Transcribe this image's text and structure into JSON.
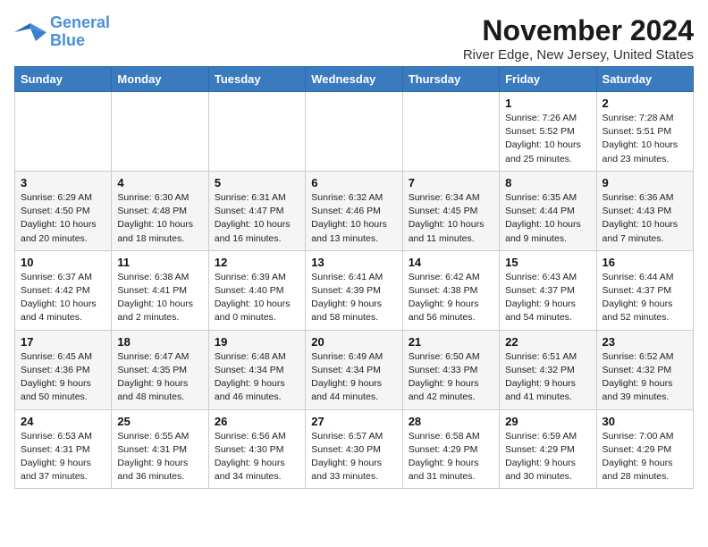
{
  "logo": {
    "line1": "General",
    "line2": "Blue"
  },
  "title": "November 2024",
  "location": "River Edge, New Jersey, United States",
  "weekdays": [
    "Sunday",
    "Monday",
    "Tuesday",
    "Wednesday",
    "Thursday",
    "Friday",
    "Saturday"
  ],
  "weeks": [
    [
      {
        "day": "",
        "info": ""
      },
      {
        "day": "",
        "info": ""
      },
      {
        "day": "",
        "info": ""
      },
      {
        "day": "",
        "info": ""
      },
      {
        "day": "",
        "info": ""
      },
      {
        "day": "1",
        "info": "Sunrise: 7:26 AM\nSunset: 5:52 PM\nDaylight: 10 hours\nand 25 minutes."
      },
      {
        "day": "2",
        "info": "Sunrise: 7:28 AM\nSunset: 5:51 PM\nDaylight: 10 hours\nand 23 minutes."
      }
    ],
    [
      {
        "day": "3",
        "info": "Sunrise: 6:29 AM\nSunset: 4:50 PM\nDaylight: 10 hours\nand 20 minutes."
      },
      {
        "day": "4",
        "info": "Sunrise: 6:30 AM\nSunset: 4:48 PM\nDaylight: 10 hours\nand 18 minutes."
      },
      {
        "day": "5",
        "info": "Sunrise: 6:31 AM\nSunset: 4:47 PM\nDaylight: 10 hours\nand 16 minutes."
      },
      {
        "day": "6",
        "info": "Sunrise: 6:32 AM\nSunset: 4:46 PM\nDaylight: 10 hours\nand 13 minutes."
      },
      {
        "day": "7",
        "info": "Sunrise: 6:34 AM\nSunset: 4:45 PM\nDaylight: 10 hours\nand 11 minutes."
      },
      {
        "day": "8",
        "info": "Sunrise: 6:35 AM\nSunset: 4:44 PM\nDaylight: 10 hours\nand 9 minutes."
      },
      {
        "day": "9",
        "info": "Sunrise: 6:36 AM\nSunset: 4:43 PM\nDaylight: 10 hours\nand 7 minutes."
      }
    ],
    [
      {
        "day": "10",
        "info": "Sunrise: 6:37 AM\nSunset: 4:42 PM\nDaylight: 10 hours\nand 4 minutes."
      },
      {
        "day": "11",
        "info": "Sunrise: 6:38 AM\nSunset: 4:41 PM\nDaylight: 10 hours\nand 2 minutes."
      },
      {
        "day": "12",
        "info": "Sunrise: 6:39 AM\nSunset: 4:40 PM\nDaylight: 10 hours\nand 0 minutes."
      },
      {
        "day": "13",
        "info": "Sunrise: 6:41 AM\nSunset: 4:39 PM\nDaylight: 9 hours\nand 58 minutes."
      },
      {
        "day": "14",
        "info": "Sunrise: 6:42 AM\nSunset: 4:38 PM\nDaylight: 9 hours\nand 56 minutes."
      },
      {
        "day": "15",
        "info": "Sunrise: 6:43 AM\nSunset: 4:37 PM\nDaylight: 9 hours\nand 54 minutes."
      },
      {
        "day": "16",
        "info": "Sunrise: 6:44 AM\nSunset: 4:37 PM\nDaylight: 9 hours\nand 52 minutes."
      }
    ],
    [
      {
        "day": "17",
        "info": "Sunrise: 6:45 AM\nSunset: 4:36 PM\nDaylight: 9 hours\nand 50 minutes."
      },
      {
        "day": "18",
        "info": "Sunrise: 6:47 AM\nSunset: 4:35 PM\nDaylight: 9 hours\nand 48 minutes."
      },
      {
        "day": "19",
        "info": "Sunrise: 6:48 AM\nSunset: 4:34 PM\nDaylight: 9 hours\nand 46 minutes."
      },
      {
        "day": "20",
        "info": "Sunrise: 6:49 AM\nSunset: 4:34 PM\nDaylight: 9 hours\nand 44 minutes."
      },
      {
        "day": "21",
        "info": "Sunrise: 6:50 AM\nSunset: 4:33 PM\nDaylight: 9 hours\nand 42 minutes."
      },
      {
        "day": "22",
        "info": "Sunrise: 6:51 AM\nSunset: 4:32 PM\nDaylight: 9 hours\nand 41 minutes."
      },
      {
        "day": "23",
        "info": "Sunrise: 6:52 AM\nSunset: 4:32 PM\nDaylight: 9 hours\nand 39 minutes."
      }
    ],
    [
      {
        "day": "24",
        "info": "Sunrise: 6:53 AM\nSunset: 4:31 PM\nDaylight: 9 hours\nand 37 minutes."
      },
      {
        "day": "25",
        "info": "Sunrise: 6:55 AM\nSunset: 4:31 PM\nDaylight: 9 hours\nand 36 minutes."
      },
      {
        "day": "26",
        "info": "Sunrise: 6:56 AM\nSunset: 4:30 PM\nDaylight: 9 hours\nand 34 minutes."
      },
      {
        "day": "27",
        "info": "Sunrise: 6:57 AM\nSunset: 4:30 PM\nDaylight: 9 hours\nand 33 minutes."
      },
      {
        "day": "28",
        "info": "Sunrise: 6:58 AM\nSunset: 4:29 PM\nDaylight: 9 hours\nand 31 minutes."
      },
      {
        "day": "29",
        "info": "Sunrise: 6:59 AM\nSunset: 4:29 PM\nDaylight: 9 hours\nand 30 minutes."
      },
      {
        "day": "30",
        "info": "Sunrise: 7:00 AM\nSunset: 4:29 PM\nDaylight: 9 hours\nand 28 minutes."
      }
    ]
  ]
}
